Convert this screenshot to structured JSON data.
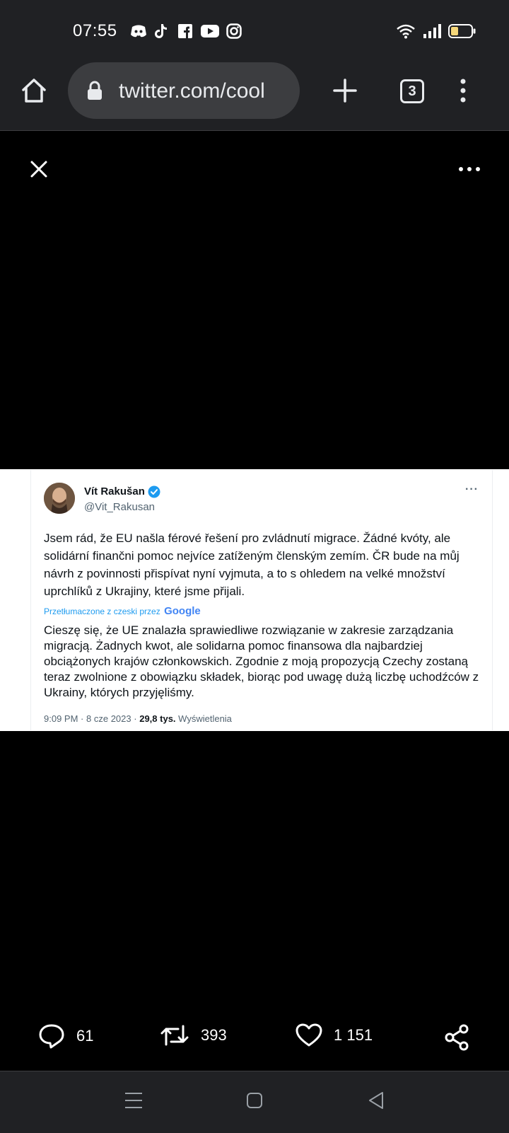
{
  "status_bar": {
    "time": "07:55",
    "notification_icons": [
      "discord-icon",
      "tiktok-icon",
      "facebook-icon",
      "youtube-icon",
      "instagram-icon"
    ],
    "system_icons": [
      "wifi-icon",
      "signal-icon",
      "battery-icon"
    ]
  },
  "browser": {
    "url": "twitter.com/cool",
    "tab_count": "3"
  },
  "viewer": {
    "close_icon": "close-icon",
    "more_icon": "more-icon"
  },
  "tweet": {
    "author_name": "Vít Rakušan",
    "author_handle": "@Vit_Rakusan",
    "verified": true,
    "original_text": "Jsem rád, že EU našla férové řešení pro zvládnutí migrace. Žádné kvóty, ale solidární finančni pomoc nejvíce zatíženým členským zemím. ČR bude na můj návrh z povinnosti přispívat nyní vyjmuta, a to s ohledem na velké množství uprchlíků z Ukrajiny, které jsme přijali.",
    "translated_by": "Przetłumaczone z czeski przez",
    "translator_logo": "Google",
    "translated_text": "Cieszę się, że UE znalazła sprawiedliwe rozwiązanie w zakresie zarządzania migracją. Żadnych kwot, ale solidarna pomoc finansowa dla najbardziej obciążonych krajów członkowskich. Zgodnie z moją propozycją Czechy zostaną teraz zwolnione z obowiązku składek, biorąc pod uwagę dużą liczbę uchodźców z Ukrainy, których przyjęliśmy.",
    "time": "9:09 PM",
    "separator": "·",
    "date": "8 cze 2023",
    "views_count": "29,8 tys.",
    "views_label": "Wyświetlenia"
  },
  "actions": {
    "reply_count": "61",
    "retweet_count": "393",
    "like_count": "1 151"
  },
  "colors": {
    "chrome_bg": "#202124",
    "verified_blue": "#1d9bf0",
    "text_dark": "#0f1419",
    "text_muted": "#536471"
  }
}
